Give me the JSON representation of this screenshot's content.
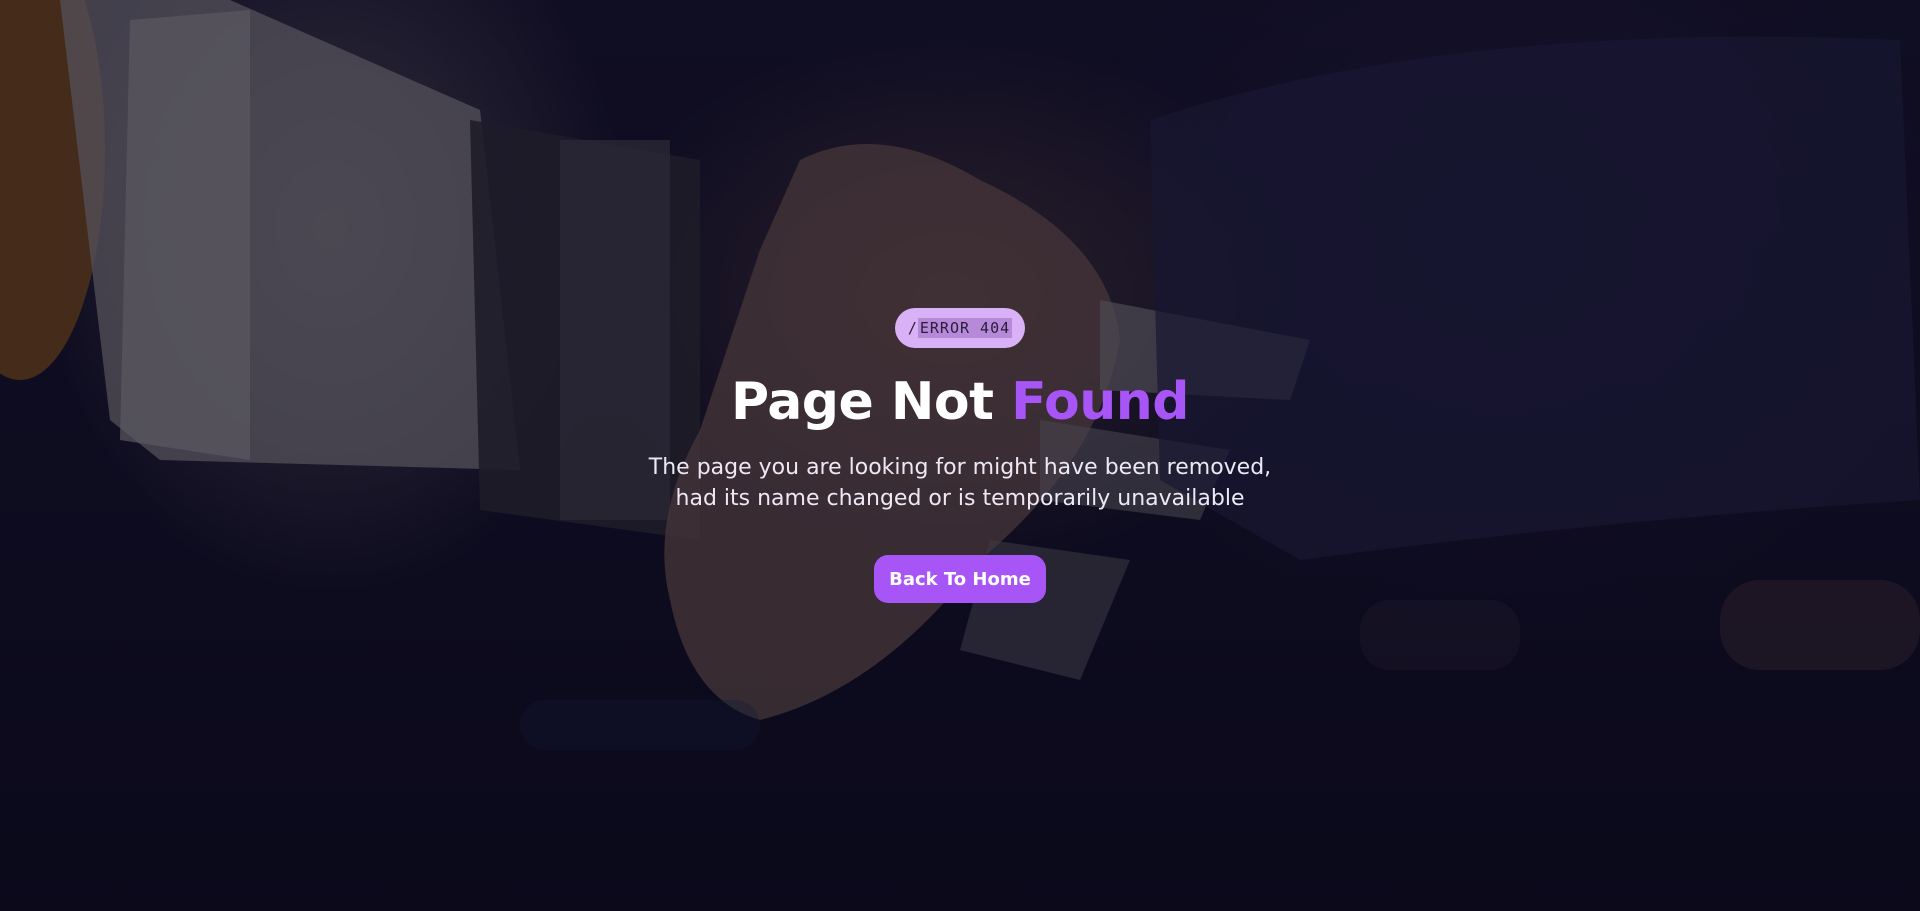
{
  "badge": {
    "prefix": "/",
    "code": "ERROR 404"
  },
  "heading": {
    "main": "Page Not ",
    "accent": "Found"
  },
  "description": {
    "line1": "The page you are looking for might have been removed,",
    "line2": "had its name changed or is temporarily unavailable"
  },
  "button": {
    "label": "Back To Home"
  },
  "colors": {
    "accent": "#a855f7",
    "badge_bg": "#d9b1f6",
    "background": "#0d0b1e"
  },
  "background_image": "robot-human-handshake"
}
